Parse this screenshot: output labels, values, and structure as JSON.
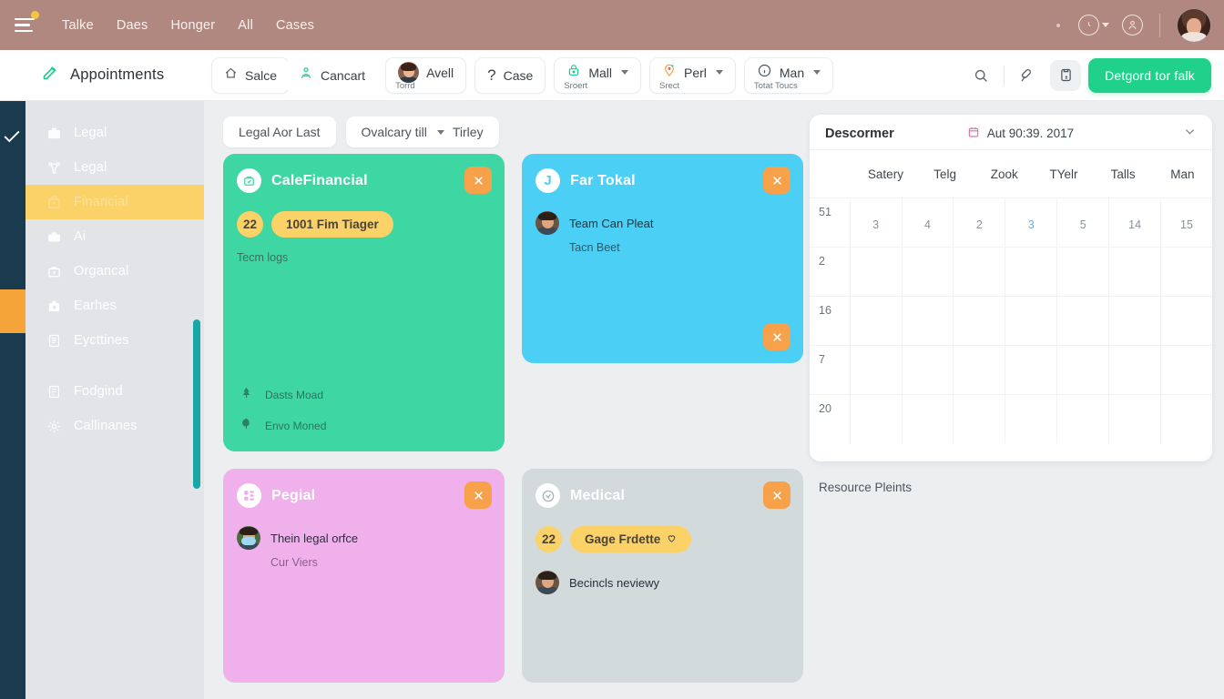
{
  "topbar": {
    "menu_badge": "notification-dot",
    "nav": [
      {
        "label": "Talke"
      },
      {
        "label": "Daes"
      },
      {
        "label": "Honger"
      },
      {
        "label": "All"
      },
      {
        "label": "Cases"
      }
    ],
    "clock_icon": "clock-icon",
    "account_icon": "user-circle-icon",
    "avatar": "user-avatar"
  },
  "toolbar": {
    "brand": "Appointments",
    "brand_icon": "edit-pencil-icon",
    "buttons": [
      {
        "icon": "home-icon",
        "label": "Salce",
        "sub": ""
      },
      {
        "icon": "person-add-icon",
        "label": "Cancart",
        "sub": ""
      },
      {
        "icon": "avatar-icon",
        "label": "Avell",
        "sub": "Torrd"
      },
      {
        "icon": "question-icon",
        "label": "Case",
        "sub": ""
      },
      {
        "icon": "lock-icon",
        "label": "Mall",
        "sub": "Sroert",
        "chevron": true
      },
      {
        "icon": "pin-icon",
        "label": "Perl",
        "sub": "Srect",
        "chevron": true
      },
      {
        "icon": "info-icon",
        "label": "Man",
        "sub": "Totat Toucs",
        "chevron": true
      }
    ],
    "search_icon": "search-icon",
    "edit_icon": "pen-icon",
    "note_icon": "note-lock-icon",
    "cta_label": "Detgord tor falk",
    "cta_color": "#1fd18b"
  },
  "sidebar": {
    "active_index": 2,
    "check_icon": "check-icon",
    "items": [
      {
        "icon": "briefcase-icon",
        "label": "Legal"
      },
      {
        "icon": "network-icon",
        "label": "Legal"
      },
      {
        "icon": "bag-icon",
        "label": "Financial"
      },
      {
        "icon": "case-icon",
        "label": "Ai"
      },
      {
        "icon": "toolbox-icon",
        "label": "Organcal"
      },
      {
        "icon": "suitcase-icon",
        "label": "Earhes"
      },
      {
        "icon": "clipboard-icon",
        "label": "Eycttines"
      }
    ],
    "items_lower": [
      {
        "icon": "list-icon",
        "label": "Fodgind"
      },
      {
        "icon": "settings-icon",
        "label": "Callinanes"
      }
    ],
    "scrollbar_color": "#17a7a7",
    "active_bg": "#fbd268",
    "strip_color": "#193a4f"
  },
  "filters": {
    "chip1": "Legal Aor Last",
    "chip2_label": "Ovalcary till",
    "chip2_value": "Tirley",
    "close_icon": "close-icon"
  },
  "cards": [
    {
      "id": "card-financial",
      "title": "CaleFinancial",
      "color": "#3ed7a3",
      "badge_icon": "bag-check-icon",
      "close_icon": "close-icon",
      "pill_num": "22",
      "pill_text": "1001 Fim Tiager",
      "pill_icon": "",
      "subtitle": "Tecm logs",
      "statuses": [
        {
          "icon": "tree-icon",
          "label": "Dasts Moad"
        },
        {
          "icon": "leaf-icon",
          "label": "Envo Moned"
        }
      ]
    },
    {
      "id": "card-far-tokal",
      "title": "Far Tokal",
      "color": "#4ccff4",
      "badge_icon": "j-letter-icon",
      "close_icon": "close-icon",
      "person": "Team Can Pleat",
      "note": "Tacn Beet",
      "has_bottom_close": true
    },
    {
      "id": "card-pegial",
      "title": "Pegial",
      "color": "#efb0ec",
      "badge_icon": "grid-icon",
      "close_icon": "close-icon",
      "person": "Thein legal orfce",
      "note": "Cur Viers"
    },
    {
      "id": "card-medical",
      "title": "Medical",
      "color": "#d2dadc",
      "badge_icon": "check-circle-icon",
      "close_icon": "close-icon",
      "pill_num": "22",
      "pill_text": "Gage Frdette",
      "pill_icon": "heart-icon",
      "person": "Becincls neviewy"
    }
  ],
  "right_panel": {
    "title": "Descormer",
    "date": "Aut 90:39. 2017",
    "date_icon": "calendar-icon",
    "chevron_icon": "chevron-down-icon",
    "columns": [
      "Satery",
      "Telg",
      "Zook",
      "TYelr",
      "Talls",
      "Man"
    ],
    "rows": [
      {
        "row_label": "51",
        "cells": [
          "3",
          "4",
          "2",
          "3",
          "5",
          "14",
          "15"
        ],
        "highlight_index": 3
      },
      {
        "row_label": "2",
        "cells": [
          "",
          "",
          "",
          "",
          "",
          "",
          ""
        ]
      },
      {
        "row_label": "16",
        "cells": [
          "",
          "",
          "",
          "",
          "",
          "",
          ""
        ]
      },
      {
        "row_label": "7",
        "cells": [
          "",
          "",
          "",
          "",
          "",
          "",
          ""
        ]
      },
      {
        "row_label": "20",
        "cells": [
          "",
          "",
          "",
          "",
          "",
          "",
          ""
        ]
      }
    ],
    "footnote": "Resource Pleints"
  }
}
